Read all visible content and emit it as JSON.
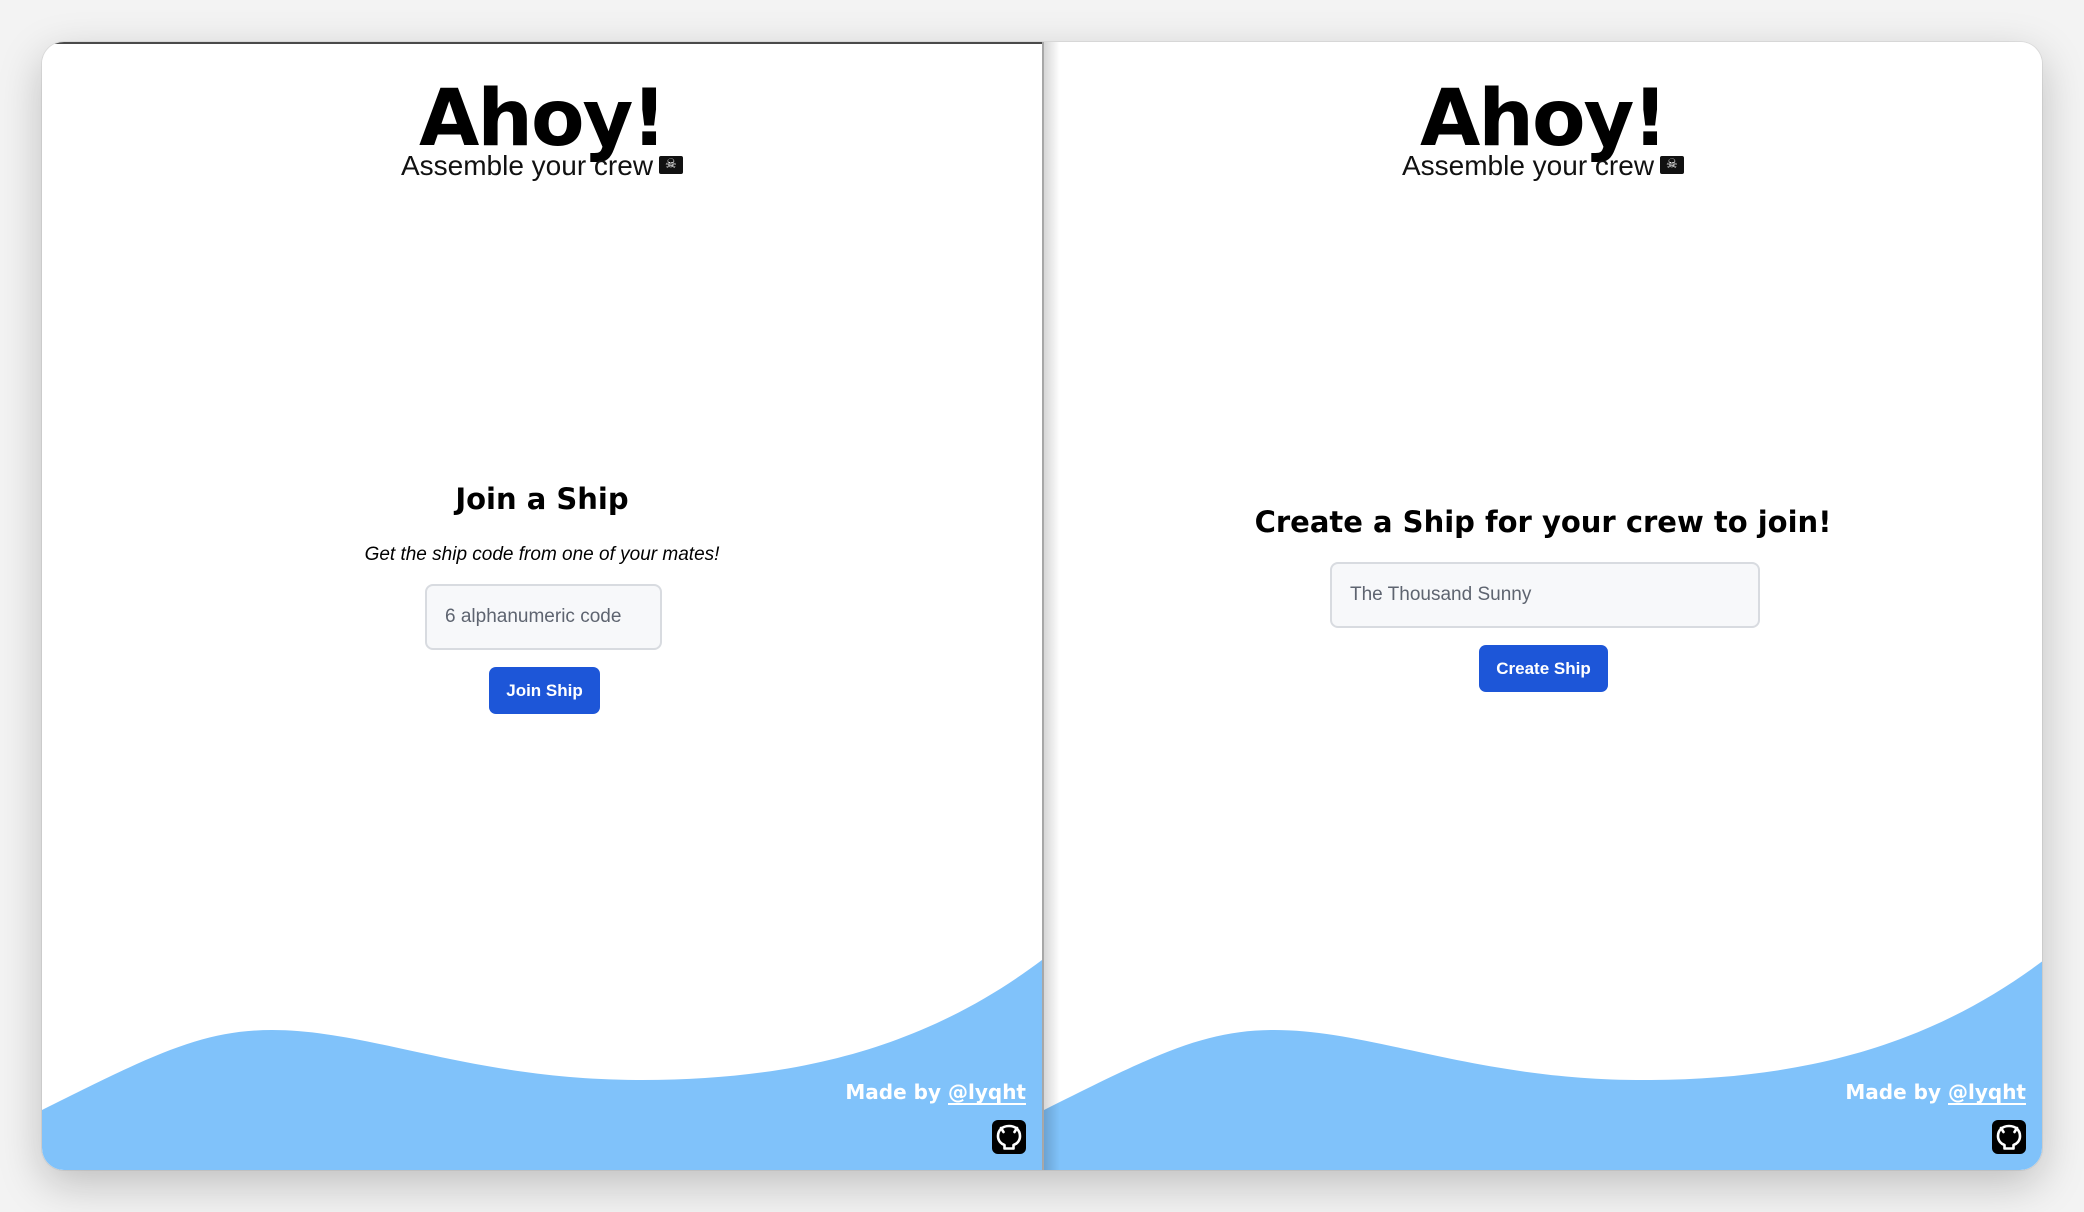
{
  "left": {
    "title": "Ahoy!",
    "subtitle": "Assemble your crew",
    "heading": "Join a Ship",
    "hint": "Get the ship code from one of your mates!",
    "input_placeholder": "6 alphanumeric code",
    "button": "Join Ship",
    "footer_prefix": "Made by",
    "footer_link": "@lyqht"
  },
  "right": {
    "title": "Ahoy!",
    "subtitle": "Assemble your crew",
    "heading": "Create a Ship for your crew to join!",
    "input_placeholder": "The Thousand Sunny",
    "button": "Create Ship",
    "footer_prefix": "Made by",
    "footer_link": "@lyqht"
  },
  "colors": {
    "wave": "#80c2fa",
    "button": "#1d56d8"
  },
  "icons": [
    "pirate-flag-icon",
    "github-icon"
  ]
}
